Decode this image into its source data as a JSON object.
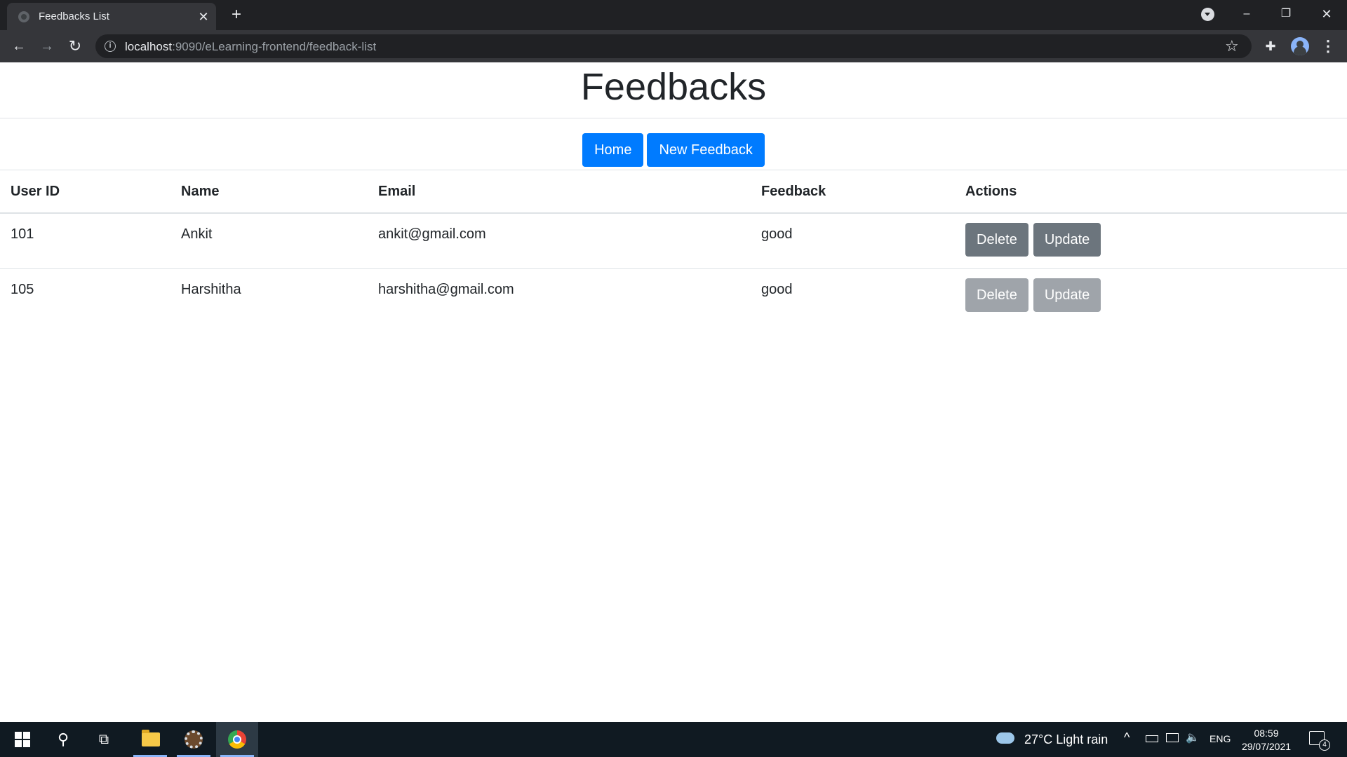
{
  "browser": {
    "tab_title": "Feedbacks List",
    "tab_close_icon": "close-icon",
    "new_tab_icon": "plus-icon",
    "window_controls": {
      "minimize": "–",
      "restore": "❐",
      "close": "✕"
    },
    "url_host": "localhost",
    "url_rest": ":9090/eLearning-frontend/feedback-list",
    "nav_icons": {
      "back": "←",
      "forward": "→",
      "reload": "↻",
      "star": "☆",
      "menu": "⋮",
      "extensions": "✚"
    }
  },
  "page": {
    "title": "Feedbacks",
    "buttons": {
      "home": "Home",
      "new_feedback": "New Feedback"
    },
    "table": {
      "headers": {
        "user_id": "User ID",
        "name": "Name",
        "email": "Email",
        "feedback": "Feedback",
        "actions": "Actions"
      },
      "rows": [
        {
          "user_id": "101",
          "name": "Ankit",
          "email": "ankit@gmail.com",
          "feedback": "good",
          "delete_label": "Delete",
          "update_label": "Update"
        },
        {
          "user_id": "105",
          "name": "Harshitha",
          "email": "harshitha@gmail.com",
          "feedback": "good",
          "delete_label": "Delete",
          "update_label": "Update"
        }
      ]
    }
  },
  "taskbar": {
    "weather": "27°C  Light rain",
    "tray_chevron": "^",
    "volume": "🔈",
    "lang": "ENG",
    "time": "08:59",
    "date": "29/07/2021",
    "notification_count": "4"
  },
  "colors": {
    "primary": "#007bff",
    "secondary": "#6c757d",
    "chrome_dark": "#202124",
    "taskbar": "#101a22"
  }
}
